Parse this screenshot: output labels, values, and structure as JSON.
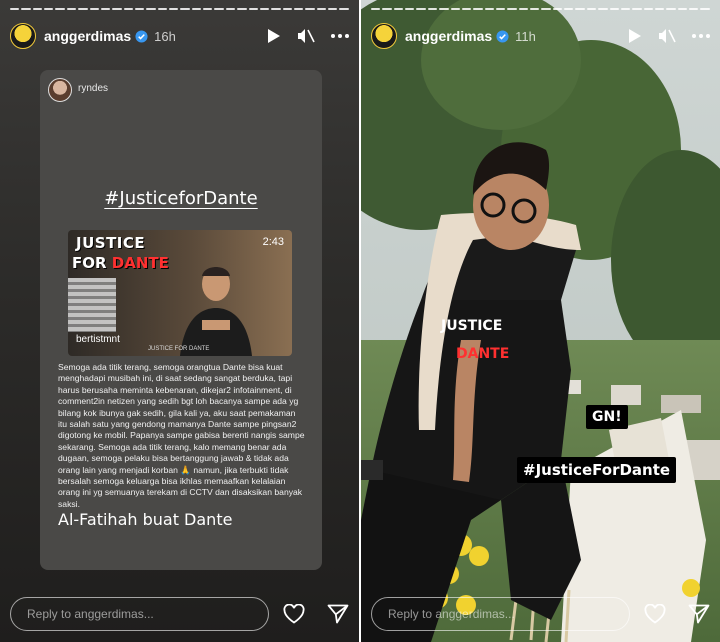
{
  "stories": [
    {
      "username": "anggerdimas",
      "time": "16h",
      "reply_placeholder": "Reply to anggerdimas...",
      "repost": {
        "username": "ryndes",
        "title": "#JusticeforDante",
        "video": {
          "title_line1": "JUSTICE",
          "title_for": "FOR",
          "title_name": "DANTE",
          "duration": "2:43",
          "handle": "bertistmnt",
          "caption": "JUSTICE FOR DANTE"
        },
        "body": "Semoga ada titik terang, semoga orangtua Dante bisa kuat menghadapi musibah ini, di saat sedang sangat berduka, tapi harus berusaha meminta kebenaran, dikejar2 infotainment, di comment2in netizen yang sedih bgt loh bacanya sampe ada yg bilang kok ibunya gak sedih, gila kali ya, aku saat pemakaman itu salah satu yang gendong mamanya Dante sampe pingsan2 digotong ke mobil. Papanya sampe gabisa berenti nangis sampe sekarang. Semoga ada titik terang, kalo memang benar ada dugaan, semoga pelaku bisa bertanggung jawab & tidak ada orang lain yang menjadi korban 🙏 namun, jika terbukti tidak bersalah semoga keluarga bisa ikhlas memaafkan kelalaian orang ini yg semuanya terekam di CCTV dan disaksikan banyak saksi.",
        "closing": "Al-Fatihah buat Dante"
      }
    },
    {
      "username": "anggerdimas",
      "time": "11h",
      "reply_placeholder": "Reply to anggerdimas...",
      "stickers": {
        "gn": "GN!",
        "hashtag": "#JusticeForDante"
      },
      "photo_shirt_text": [
        "JUSTICE",
        "DANTE"
      ]
    }
  ],
  "colors": {
    "hashtag_red": "#ff3030",
    "sticker_bg": "#000000",
    "avatar_ring": "#f0c93a"
  },
  "icons": [
    "verified-icon",
    "play-icon",
    "mute-icon",
    "more-icon",
    "heart-icon",
    "send-icon"
  ]
}
